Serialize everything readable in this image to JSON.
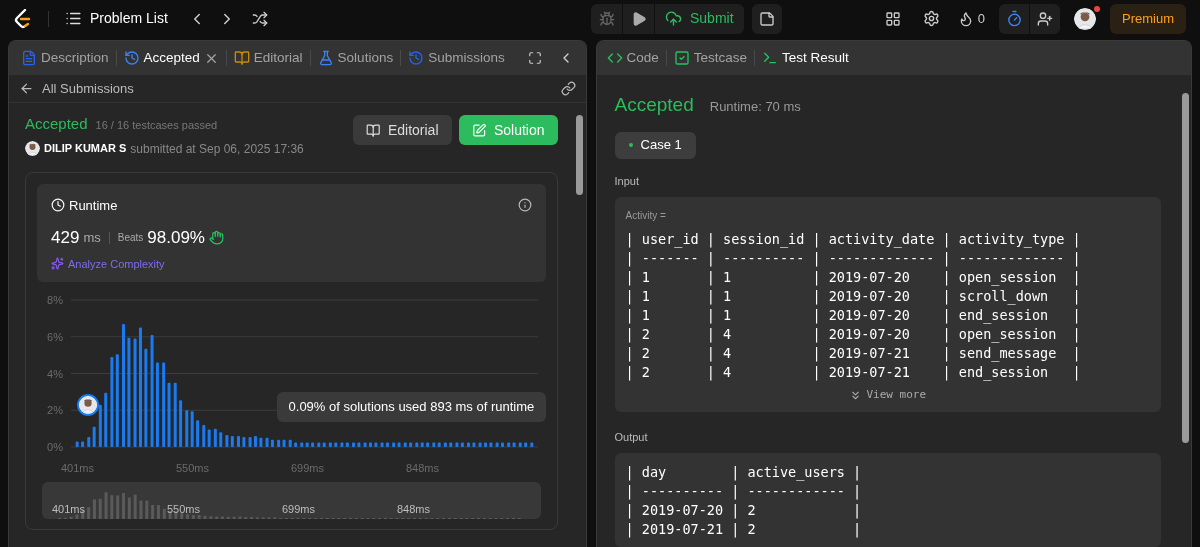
{
  "top_bar": {
    "title": "Problem List",
    "submit": "Submit",
    "streak": "0",
    "premium": "Premium",
    "notification": true
  },
  "left_panel": {
    "tabs": [
      {
        "label": "Description",
        "kind": "description",
        "selected": false,
        "closable": false
      },
      {
        "label": "Accepted",
        "kind": "history",
        "selected": true,
        "closable": true
      },
      {
        "label": "Editorial",
        "kind": "book",
        "selected": false,
        "closable": false
      },
      {
        "label": "Solutions",
        "kind": "flask",
        "selected": false,
        "closable": false
      },
      {
        "label": "Submissions",
        "kind": "history",
        "selected": false,
        "closable": false
      }
    ],
    "back_link": "All Submissions",
    "submission": {
      "status": "Accepted",
      "testcases": "16 / 16 testcases passed",
      "user": "DILIP KUMAR S",
      "submitted": "submitted at Sep 06, 2025 17:36"
    },
    "buttons": [
      {
        "label": "Editorial",
        "kind": "secondary"
      },
      {
        "label": "Solution",
        "kind": "primary"
      }
    ],
    "runtime": {
      "title": "Runtime",
      "value": "429",
      "unit": "ms",
      "beats_label": "Beats",
      "beats": "98.09%",
      "analyze": "Analyze Complexity"
    },
    "chart_data": {
      "type": "bar",
      "grid": true,
      "xlim": [
        393,
        998
      ],
      "ylim": [
        0,
        8
      ],
      "x": [
        401,
        408,
        416,
        423,
        431,
        438,
        446,
        453,
        461,
        468,
        476,
        483,
        490,
        498,
        505,
        513,
        520,
        528,
        535,
        543,
        550,
        557,
        565,
        572,
        580,
        587,
        595,
        602,
        610,
        617,
        625,
        632,
        639,
        647,
        654,
        662,
        669,
        677,
        684,
        692,
        699,
        706,
        714,
        721,
        729,
        736,
        744,
        751,
        759,
        766,
        774,
        781,
        788,
        796,
        803,
        811,
        818,
        826,
        833,
        841,
        848,
        855,
        863,
        870,
        878,
        885,
        893,
        900,
        908,
        915,
        923,
        930,
        937,
        945,
        952,
        960,
        967,
        975,
        982,
        990
      ],
      "yticks": [
        {
          "value": 0,
          "label": "0%"
        },
        {
          "value": 2,
          "label": "2%"
        },
        {
          "value": 4,
          "label": "4%"
        },
        {
          "value": 6,
          "label": "6%"
        },
        {
          "value": 8,
          "label": "8%"
        }
      ],
      "xticks": [
        {
          "value": 401,
          "label": "401ms"
        },
        {
          "value": 550,
          "label": "550ms"
        },
        {
          "value": 699,
          "label": "699ms"
        },
        {
          "value": 848,
          "label": "848ms"
        }
      ],
      "values": [
        0.3,
        0.3,
        0.55,
        1.1,
        2.3,
        2.95,
        4.9,
        5.05,
        6.7,
        5.95,
        5.9,
        6.5,
        5.35,
        6.1,
        4.6,
        4.6,
        3.5,
        3.5,
        2.55,
        2.0,
        1.95,
        1.45,
        1.2,
        0.95,
        1.0,
        0.8,
        0.65,
        0.6,
        0.6,
        0.55,
        0.55,
        0.6,
        0.5,
        0.5,
        0.4,
        0.4,
        0.4,
        0.4,
        0.25,
        0.25,
        0.25,
        0.25,
        0.25,
        0.25,
        0.25,
        0.25,
        0.25,
        0.25,
        0.25,
        0.25,
        0.25,
        0.25,
        0.25,
        0.25,
        0.25,
        0.25,
        0.25,
        0.25,
        0.25,
        0.25,
        0.25,
        0.25,
        0.25,
        0.25,
        0.25,
        0.25,
        0.25,
        0.25,
        0.25,
        0.25,
        0.25,
        0.25,
        0.25,
        0.25,
        0.25,
        0.25,
        0.25,
        0.25,
        0.25,
        0.25
      ],
      "annotations": [
        "0.09% of solutions used 893 ms of runtime"
      ]
    },
    "navigator_labels": [
      "401ms",
      "550ms",
      "699ms",
      "848ms"
    ]
  },
  "right_panel": {
    "tabs": [
      {
        "label": "Code",
        "kind": "code",
        "selected": false
      },
      {
        "label": "Testcase",
        "kind": "check",
        "selected": false
      },
      {
        "label": "Test Result",
        "kind": "terminal",
        "selected": true
      }
    ],
    "result": {
      "status": "Accepted",
      "runtime": "Runtime: 70 ms"
    },
    "cases": [
      {
        "label": "Case 1",
        "selected": true
      }
    ],
    "input_label": "Input",
    "input": {
      "name": "Activity =",
      "lines": [
        "| user_id | session_id | activity_date | activity_type |",
        "| ------- | ---------- | ------------- | ------------- |",
        "| 1       | 1          | 2019-07-20    | open_session  |",
        "| 1       | 1          | 2019-07-20    | scroll_down   |",
        "| 1       | 1          | 2019-07-20    | end_session   |",
        "| 2       | 4          | 2019-07-20    | open_session  |",
        "| 2       | 4          | 2019-07-21    | send_message  |",
        "| 2       | 4          | 2019-07-21    | end_session   |"
      ],
      "view_more": "View more"
    },
    "output_label": "Output",
    "output": {
      "lines": [
        "| day        | active_users |",
        "| ---------- | ------------ |",
        "| 2019-07-20 | 2            |",
        "| 2019-07-21 | 2            |"
      ]
    }
  }
}
